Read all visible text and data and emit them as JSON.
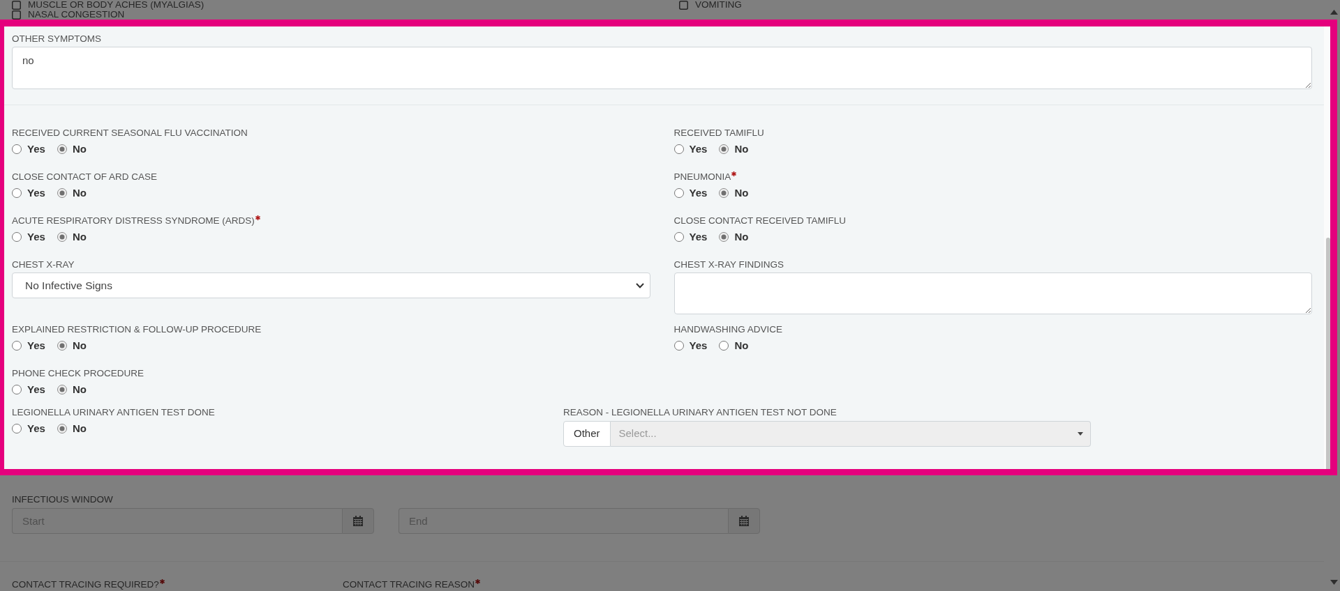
{
  "symptom_checkboxes": [
    {
      "label": "MUSCLE OR BODY ACHES (MYALGIAS)",
      "checked": false
    },
    {
      "label": "VOMITING",
      "checked": false
    },
    {
      "label": "NASAL CONGESTION",
      "checked": false
    }
  ],
  "highlighted_section": {
    "other_symptoms": {
      "label": "OTHER SYMPTOMS",
      "value": "no"
    },
    "fields": [
      {
        "kind": "radio",
        "label": "RECEIVED CURRENT SEASONAL FLU VACCINATION",
        "required": false,
        "options": [
          {
            "label": "Yes",
            "selected": false
          },
          {
            "label": "No",
            "selected": true
          }
        ]
      },
      {
        "kind": "radio",
        "label": "RECEIVED TAMIFLU",
        "required": false,
        "options": [
          {
            "label": "Yes",
            "selected": false
          },
          {
            "label": "No",
            "selected": true
          }
        ]
      },
      {
        "kind": "radio",
        "label": "CLOSE CONTACT OF ARD CASE",
        "required": false,
        "options": [
          {
            "label": "Yes",
            "selected": false
          },
          {
            "label": "No",
            "selected": true
          }
        ]
      },
      {
        "kind": "radio",
        "label": "PNEUMONIA",
        "required": true,
        "options": [
          {
            "label": "Yes",
            "selected": false
          },
          {
            "label": "No",
            "selected": true
          }
        ]
      },
      {
        "kind": "radio",
        "label": "ACUTE RESPIRATORY DISTRESS SYNDROME (ARDS)",
        "required": true,
        "options": [
          {
            "label": "Yes",
            "selected": false
          },
          {
            "label": "No",
            "selected": true
          }
        ]
      },
      {
        "kind": "radio",
        "label": "CLOSE CONTACT RECEIVED TAMIFLU",
        "required": false,
        "options": [
          {
            "label": "Yes",
            "selected": false
          },
          {
            "label": "No",
            "selected": true
          }
        ]
      },
      {
        "kind": "select",
        "label": "CHEST X-RAY",
        "required": false,
        "value": "No Infective Signs"
      },
      {
        "kind": "textarea",
        "label": "CHEST X-RAY FINDINGS",
        "required": false
      },
      {
        "kind": "radio",
        "label": "EXPLAINED RESTRICTION & FOLLOW-UP PROCEDURE",
        "required": false,
        "options": [
          {
            "label": "Yes",
            "selected": false
          },
          {
            "label": "No",
            "selected": true
          }
        ]
      },
      {
        "kind": "radio",
        "label": "HANDWASHING ADVICE",
        "required": false,
        "options": [
          {
            "label": "Yes",
            "selected": false
          },
          {
            "label": "No",
            "selected": false
          }
        ]
      },
      {
        "kind": "radio",
        "label": "PHONE CHECK PROCEDURE",
        "required": false,
        "options": [
          {
            "label": "Yes",
            "selected": false
          },
          {
            "label": "No",
            "selected": true
          }
        ]
      }
    ],
    "legionella_row": [
      {
        "kind": "radio",
        "label": "LEGIONELLA URINARY ANTIGEN TEST DONE",
        "required": false,
        "options": [
          {
            "label": "Yes",
            "selected": false
          },
          {
            "label": "No",
            "selected": true
          }
        ]
      },
      {
        "kind": "addon_select",
        "label": "REASON - LEGIONELLA URINARY ANTIGEN TEST NOT DONE",
        "required": false,
        "addon": "Other",
        "placeholder": "Select...",
        "disabled": true
      }
    ]
  },
  "infectious_window": {
    "label": "INFECTIOUS WINDOW",
    "start": {
      "placeholder": "Start"
    },
    "end": {
      "placeholder": "End"
    }
  },
  "contact_tracing": [
    {
      "label": "CONTACT TRACING REQUIRED?",
      "required": true
    },
    {
      "label": "CONTACT TRACING REASON",
      "required": true
    }
  ]
}
